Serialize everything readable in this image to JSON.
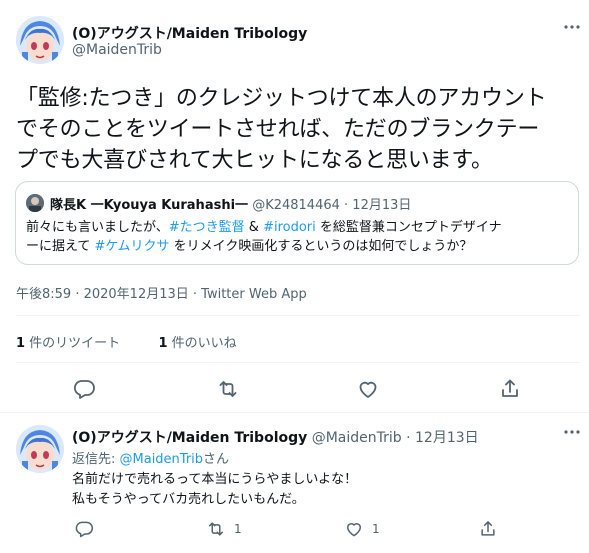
{
  "tweet": {
    "author_name": "(O)アウグスト/Maiden Tribology",
    "author_handle": "@MaidenTrib",
    "more_icon": "more-icon",
    "text_lines": [
      "「監修:たつき」のクレジットつけて本人のアカウント",
      "でそのことをツイートさせれば、ただのブランクテー",
      "プでも大喜びされて大ヒットになると思います。"
    ],
    "quote": {
      "author_name": "隊長K 一Kyouya Kurahashi一",
      "author_handle": "@K24814464",
      "date": "· 12月13日",
      "line1_before": "前々にも言いましたが、",
      "hashtag1": "#たつき監督",
      "line1_mid": " & ",
      "hashtag2": "#irodori",
      "line1_after": " を総監督兼コンセプトデザイナ",
      "line2_before": "ーに据えて ",
      "hashtag3": "#ケムリクサ",
      "line2_after": " をリメイク映画化するというのは如何でしょうか？"
    },
    "timestamp": "午後8:59 · 2020年12月13日",
    "source_sep": " · ",
    "source": "Twitter Web App",
    "retweets_count": "1",
    "retweets_label": " 件のリツイート",
    "likes_count": "1",
    "likes_label": " 件のいいね"
  },
  "reply": {
    "author_name": "(O)アウグスト/Maiden Tribology",
    "author_handle": "@MaidenTrib",
    "date": "· 12月13日",
    "replying_prefix": "返信先: ",
    "replying_handle": "@MaidenTrib",
    "replying_suffix": "さん",
    "text_lines": [
      "名前だけで売れるって本当にうらやましいよな！",
      "私もそうやってバカ売れしたいもんだ。"
    ],
    "retweet_count": "1",
    "like_count": "1"
  },
  "colors": {
    "accent": "#1d9bf0",
    "text": "#0f1419",
    "muted": "#536471",
    "border": "#cfd9de"
  }
}
